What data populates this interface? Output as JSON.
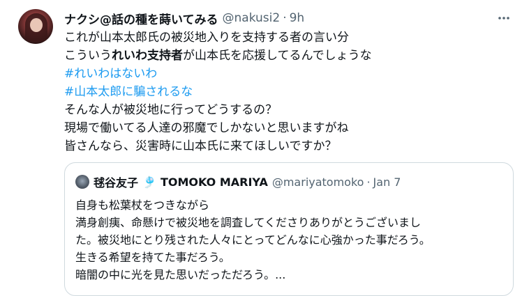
{
  "tweet": {
    "author_name": "ナクシ@話の種を蒔いてみる",
    "author_handle": "@nakusi2",
    "separator": "·",
    "time": "9h",
    "more_icon": "more-horizontal-icon",
    "lines": {
      "l1": "これが山本太郎氏の被災地入りを支持する者の言い分",
      "l2_pre": "こういう",
      "l2_bold": "れいわ支持者",
      "l2_post": "が山本氏を応援してるんでしょうな",
      "hashtag1": "#れいわはないわ",
      "hashtag2": "#山本太郎に騙されるな",
      "l5": "そんな人が被災地に行ってどうするの？",
      "l6": "現場で働いてる人達の邪魔でしかないと思いますがね",
      "l7": "皆さんなら、災害時に山本氏に来てほしいですか？"
    }
  },
  "quote": {
    "name": "毬谷友子",
    "flag_emoji": "🎐",
    "name_latin": "TOMOKO MARIYA",
    "handle": "@mariyatomoko",
    "separator": "·",
    "date": "Jan 7",
    "lines": [
      "自身も松葉杖をつきながら",
      "満身創痍、命懸けで被災地を調査してくださりありがとうございまし",
      "た。被災地にとり残された人々にとってどんなに心強かった事だろう。",
      "生きる希望を持てた事だろう。",
      "暗闇の中に光を見た思いだっただろう。..."
    ]
  },
  "colors": {
    "text": "#0f1419",
    "muted": "#536471",
    "link": "#1d9bf0",
    "border": "#cfd9de"
  }
}
